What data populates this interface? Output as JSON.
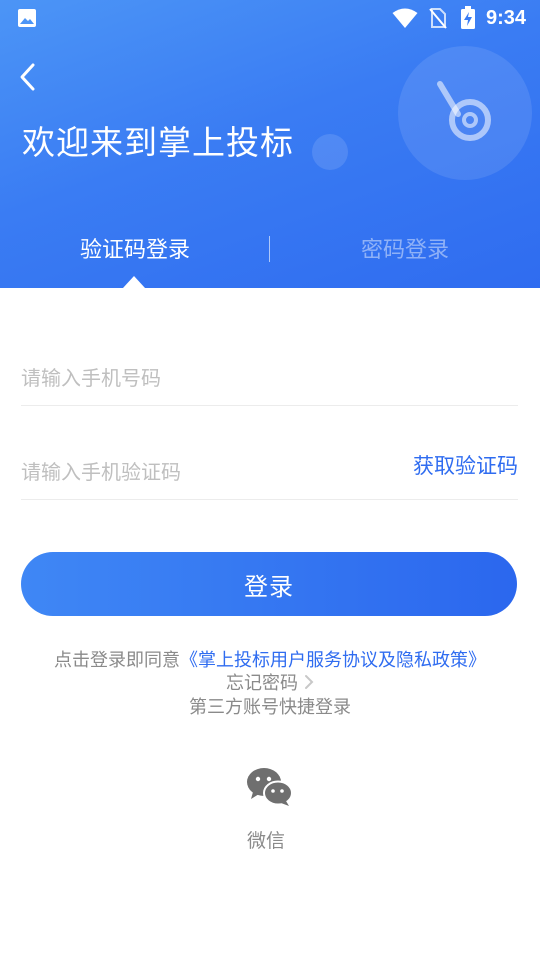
{
  "status_bar": {
    "time": "9:34",
    "icons": [
      "photo-icon",
      "wifi-icon",
      "no-sim-icon",
      "battery-charging-icon"
    ]
  },
  "header": {
    "title": "欢迎来到掌上投标",
    "back_icon": "chevron-left-icon",
    "logo_icon": "app-logo-icon"
  },
  "tabs": [
    {
      "label": "验证码登录",
      "active": true
    },
    {
      "label": "密码登录",
      "active": false
    }
  ],
  "form": {
    "phone_placeholder": "请输入手机号码",
    "phone_value": "",
    "code_placeholder": "请输入手机验证码",
    "code_value": "",
    "get_code_label": "获取验证码",
    "login_label": "登录"
  },
  "agreement": {
    "prefix": "点击登录即同意",
    "link": "《掌上投标用户服务协议及隐私政策》"
  },
  "forgot_password": "忘记密码",
  "third_party": {
    "title": "第三方账号快捷登录",
    "wechat_label": "微信"
  },
  "colors": {
    "brand": "#2f6cf0",
    "header_start": "#4c95f6",
    "header_end": "#2f6cf0",
    "muted_text": "#8a8a8a",
    "placeholder": "#bfbfbf"
  }
}
